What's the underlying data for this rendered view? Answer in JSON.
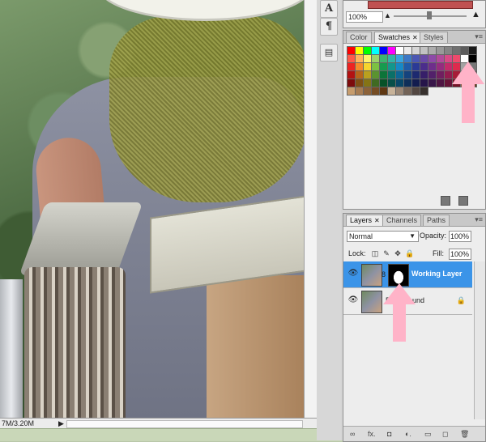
{
  "canvas": {
    "status_info": "7M/3.20M",
    "status_arrow": "▶"
  },
  "tools": {
    "type_tool_glyph": "A",
    "paragraph_glyph": "¶",
    "notes_glyph": "▤"
  },
  "navigator": {
    "zoom_value": "100%",
    "zoom_out_glyph": "▲",
    "zoom_in_glyph": "▲"
  },
  "swatches_panel": {
    "tabs": [
      {
        "label": "Color",
        "active": false,
        "closable": false
      },
      {
        "label": "Swatches",
        "active": true,
        "closable": true
      },
      {
        "label": "Styles",
        "active": false,
        "closable": false
      }
    ],
    "menu_glyph": "▾≡",
    "colors": [
      "#ff0000",
      "#ffff00",
      "#00ff00",
      "#00ffff",
      "#0000ff",
      "#ff00ff",
      "#ffffff",
      "#ebebeb",
      "#d6d6d6",
      "#c2c2c2",
      "#adadad",
      "#999999",
      "#858585",
      "#707070",
      "#5c5c5c",
      "#1a1a1a",
      "#ff5a4a",
      "#ffb65c",
      "#fff36b",
      "#9ed36a",
      "#3db470",
      "#33b4a8",
      "#3aa4de",
      "#3b78c6",
      "#4a56b3",
      "#6a4aa8",
      "#8d4aa8",
      "#b14a9a",
      "#d94a86",
      "#ef4a6c",
      "#ffffff",
      "#000000",
      "#ee2222",
      "#f58a2a",
      "#f6d62e",
      "#7cc242",
      "#169b4f",
      "#12978d",
      "#1689c6",
      "#1f5ba8",
      "#2b3a96",
      "#4b2d8c",
      "#6e2e8c",
      "#952c7f",
      "#c42a6a",
      "#de2a4d",
      "#a3a3a3",
      "#777777",
      "#b31212",
      "#b7651b",
      "#b9a01f",
      "#5a9330",
      "#0c7439",
      "#0a7068",
      "#0d6695",
      "#15437e",
      "#1d2a70",
      "#371f69",
      "#52206a",
      "#701f5f",
      "#921c4e",
      "#a71c38",
      "#5a5a5a",
      "#3c3c3c",
      "#7d0c0c",
      "#805014",
      "#857415",
      "#406a22",
      "#085228",
      "#074f49",
      "#094768",
      "#0f2f59",
      "#131d4f",
      "#26154a",
      "#39164a",
      "#4f1543",
      "#661337",
      "#751327",
      "#8a5a3a",
      "#6b4226",
      "#c69c6d",
      "#a67c52",
      "#8c6239",
      "#754c24",
      "#603813",
      "#c7b299",
      "#998675",
      "#736357",
      "#534741",
      "#37302d"
    ],
    "footer": {
      "new_glyph": "◻",
      "trash_glyph": "🗑"
    }
  },
  "layers_panel": {
    "tabs": [
      {
        "label": "Layers",
        "active": true,
        "closable": true
      },
      {
        "label": "Channels",
        "active": false,
        "closable": false
      },
      {
        "label": "Paths",
        "active": false,
        "closable": false
      }
    ],
    "menu_glyph": "▾≡",
    "blend_mode": "Normal",
    "blend_caret": "▼",
    "opacity_label": "Opacity:",
    "opacity_value": "100%",
    "lock_label": "Lock:",
    "lock_icons": [
      "◫",
      "✎",
      "✥",
      "🔒"
    ],
    "fill_label": "Fill:",
    "fill_value": "100%",
    "layers": [
      {
        "name": "Working Layer",
        "selected": true,
        "has_mask": true,
        "locked": false
      },
      {
        "name": "Background",
        "selected": false,
        "has_mask": false,
        "locked": true
      }
    ],
    "eye_glyph": "👁",
    "chain_glyph": "8",
    "lock_glyph": "🔒",
    "footer_glyphs": [
      "∞",
      "fx.",
      "◘",
      "◐.",
      "▭",
      "◻",
      "🗑"
    ]
  },
  "annotations": {
    "arrow_color": "#ffb3c8"
  }
}
